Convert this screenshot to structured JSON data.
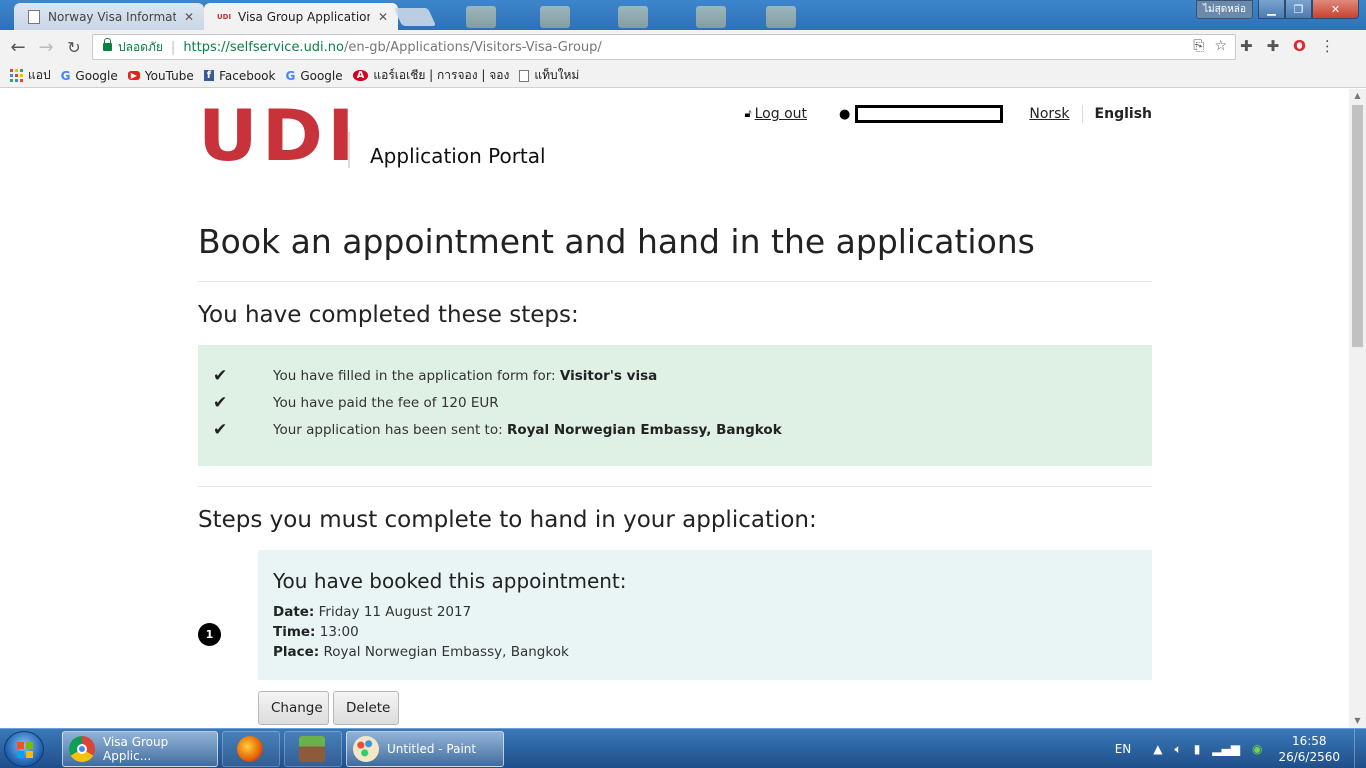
{
  "browser": {
    "tabs": [
      {
        "title": "Norway Visa Information",
        "active": false
      },
      {
        "title": "Visa Group Application -",
        "active": true
      }
    ],
    "window_badge": "ไม่สุดหล่อ",
    "secure_label": "ปลอดภัย",
    "url_host": "https://selfservice.udi.no",
    "url_path": "/en-gb/Applications/Visitors-Visa-Group/",
    "bookmarks": [
      {
        "label": "แอป",
        "icon": "apps-grid-icon"
      },
      {
        "label": "Google",
        "icon": "google-icon"
      },
      {
        "label": "YouTube",
        "icon": "youtube-icon"
      },
      {
        "label": "Facebook",
        "icon": "facebook-icon"
      },
      {
        "label": "Google",
        "icon": "google-icon"
      },
      {
        "label": "แอร์เอเชีย | การจอง | จอง",
        "icon": "airasia-icon"
      },
      {
        "label": "แท็บใหม่",
        "icon": "page-icon"
      }
    ]
  },
  "header": {
    "logo": "UDI",
    "portal": "Application Portal",
    "logout": "Log out",
    "lang_norsk": "Norsk",
    "lang_english": "English"
  },
  "main": {
    "title": "Book an appointment and hand in the applications",
    "completed_heading": "You have completed these steps:",
    "completed": [
      {
        "text": "You have filled in the application form for: ",
        "bold": "Visitor's visa"
      },
      {
        "text": "You have paid the fee of 120 EUR",
        "bold": ""
      },
      {
        "text": "Your application has been sent to: ",
        "bold": "Royal Norwegian Embassy, Bangkok"
      }
    ],
    "steps_heading": "Steps you must complete to hand in your application:",
    "step_number": "1",
    "appointment": {
      "title": "You have booked this appointment:",
      "date_label": "Date:",
      "date": "Friday 11 August 2017",
      "time_label": "Time:",
      "time": "13:00",
      "place_label": "Place:",
      "place": "Royal Norwegian Embassy, Bangkok"
    },
    "change_button": "Change",
    "delete_button": "Delete"
  },
  "taskbar": {
    "items": [
      {
        "label": "Visa Group Applic...",
        "icon": "chrome-icon"
      },
      {
        "label": "",
        "icon": "firefox-icon"
      },
      {
        "label": "",
        "icon": "minecraft-icon"
      },
      {
        "label": "Untitled - Paint",
        "icon": "paint-icon"
      }
    ],
    "language": "EN",
    "time": "16:58",
    "date": "26/6/2560"
  },
  "colors": {
    "brand_red": "#c8323b",
    "completed_bg": "#dff0e5",
    "appointment_bg": "#e9f4f5"
  }
}
